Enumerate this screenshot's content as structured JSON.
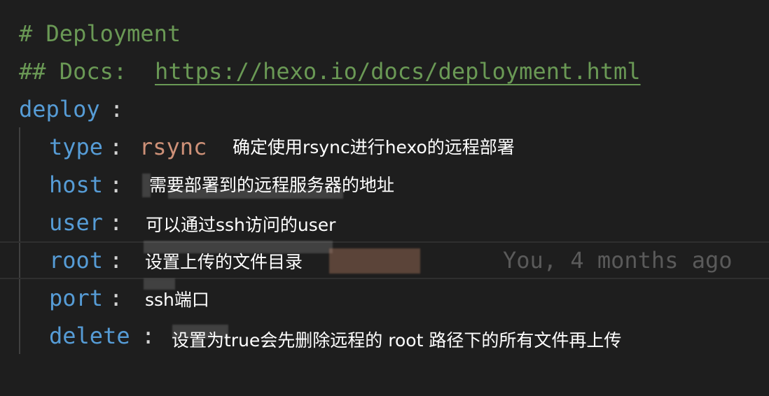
{
  "lines": {
    "comment1": "# Deployment",
    "comment2_prefix": "## Docs: ",
    "comment2_link": "https://hexo.io/docs/deployment.html",
    "deploy_key": "deploy",
    "type_key": "type",
    "type_value": "rsync",
    "host_key": "host",
    "user_key": "user",
    "root_key": "root",
    "port_key": "port",
    "delete_key": "delete",
    "colon": ":"
  },
  "blame": "You, 4 months ago",
  "notes": {
    "type": "确定使用rsync进行hexo的远程部署",
    "host": "需要部署到的远程服务器的地址",
    "user": "可以通过ssh访问的user",
    "root": "设置上传的文件目录",
    "port": "ssh端口",
    "delete": "设置为true会先删除远程的 root 路径下的所有文件再上传"
  },
  "colors": {
    "background": "#1e1e1e",
    "comment": "#6a9955",
    "key": "#569cd6",
    "string": "#ce9178",
    "blame": "#5a5a5a"
  }
}
